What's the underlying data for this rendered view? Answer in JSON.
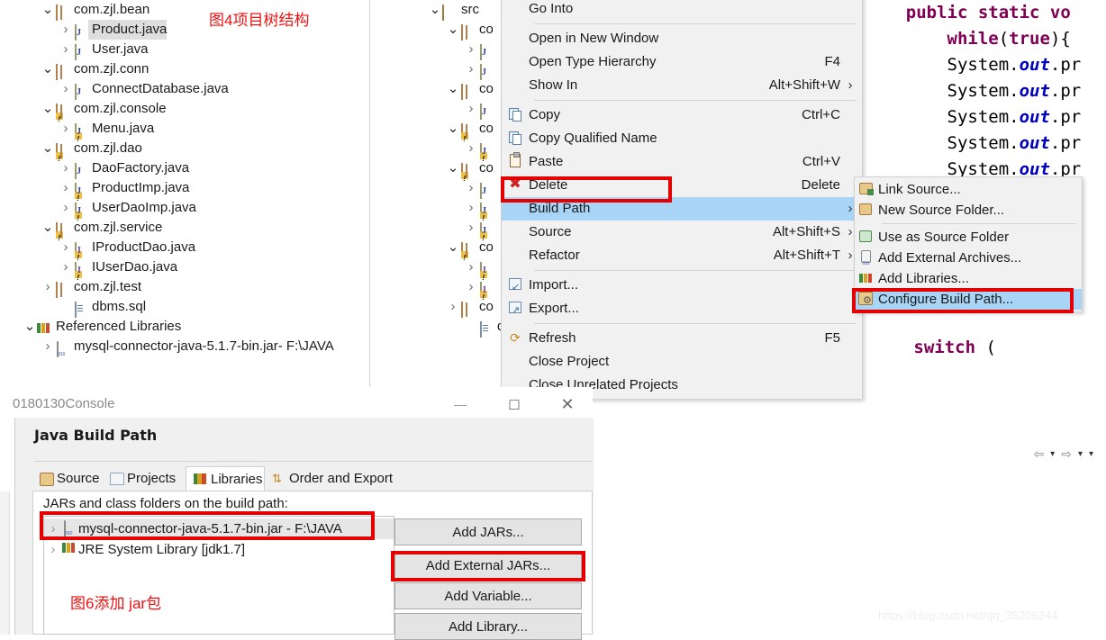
{
  "package_explorer": {
    "name": "Package Explorer Tree",
    "rows": [
      {
        "indent": 1,
        "twist": "open",
        "icon": "package-icon",
        "label": "com.zjl.bean",
        "selected": false
      },
      {
        "indent": 2,
        "twist": "closed",
        "icon": "java-file-icon",
        "label": "Product.java",
        "selected": true
      },
      {
        "indent": 2,
        "twist": "closed",
        "icon": "java-file-icon",
        "label": "User.java",
        "selected": false
      },
      {
        "indent": 1,
        "twist": "open",
        "icon": "package-icon",
        "label": "com.zjl.conn",
        "selected": false
      },
      {
        "indent": 2,
        "twist": "closed",
        "icon": "java-file-icon",
        "label": "ConnectDatabase.java",
        "selected": false
      },
      {
        "indent": 1,
        "twist": "open",
        "icon": "package-warning-icon",
        "label": "com.zjl.console",
        "selected": false
      },
      {
        "indent": 2,
        "twist": "closed",
        "icon": "java-file-warning-icon",
        "label": "Menu.java",
        "selected": false
      },
      {
        "indent": 1,
        "twist": "open",
        "icon": "package-warning-icon",
        "label": "com.zjl.dao",
        "selected": false
      },
      {
        "indent": 2,
        "twist": "closed",
        "icon": "java-file-icon",
        "label": "DaoFactory.java",
        "selected": false
      },
      {
        "indent": 2,
        "twist": "closed",
        "icon": "java-file-warning-icon",
        "label": "ProductImp.java",
        "selected": false
      },
      {
        "indent": 2,
        "twist": "closed",
        "icon": "java-file-warning-icon",
        "label": "UserDaoImp.java",
        "selected": false
      },
      {
        "indent": 1,
        "twist": "open",
        "icon": "package-warning-icon",
        "label": "com.zjl.service",
        "selected": false
      },
      {
        "indent": 2,
        "twist": "closed",
        "icon": "interface-file-warning-icon",
        "label": "IProductDao.java",
        "selected": false
      },
      {
        "indent": 2,
        "twist": "closed",
        "icon": "interface-file-warning-icon",
        "label": "IUserDao.java",
        "selected": false
      },
      {
        "indent": 1,
        "twist": "closed",
        "icon": "package-icon",
        "label": "com.zjl.test",
        "selected": false
      },
      {
        "indent": 2,
        "twist": "none",
        "icon": "sql-file-icon",
        "label": "dbms.sql",
        "selected": false
      },
      {
        "indent": 0,
        "twist": "open",
        "icon": "library-icon",
        "label": "Referenced Libraries",
        "selected": false
      },
      {
        "indent": 1,
        "twist": "closed",
        "icon": "jar-icon",
        "label": "mysql-connector-java-5.1.7-bin.jar",
        "dim": " - F:\\JAVA",
        "selected": false
      }
    ]
  },
  "second_tree": {
    "name": "Project Explorer (behind menu)",
    "rows": [
      {
        "indent": 0,
        "twist": "open",
        "icon": "source-folder-icon",
        "label": "src"
      },
      {
        "indent": 1,
        "twist": "open",
        "icon": "package-icon",
        "label": "co"
      },
      {
        "indent": 2,
        "twist": "closed",
        "icon": "java-file-icon",
        "label": ""
      },
      {
        "indent": 2,
        "twist": "closed",
        "icon": "java-file-icon",
        "label": ""
      },
      {
        "indent": 1,
        "twist": "open",
        "icon": "package-icon",
        "label": "co"
      },
      {
        "indent": 2,
        "twist": "closed",
        "icon": "java-file-icon",
        "label": ""
      },
      {
        "indent": 1,
        "twist": "open",
        "icon": "package-warning-icon",
        "label": "co"
      },
      {
        "indent": 2,
        "twist": "closed",
        "icon": "java-file-warning-icon",
        "label": ""
      },
      {
        "indent": 1,
        "twist": "open",
        "icon": "package-warning-icon",
        "label": "co"
      },
      {
        "indent": 2,
        "twist": "closed",
        "icon": "java-file-icon",
        "label": ""
      },
      {
        "indent": 2,
        "twist": "closed",
        "icon": "java-file-warning-icon",
        "label": ""
      },
      {
        "indent": 2,
        "twist": "closed",
        "icon": "java-file-warning-icon",
        "label": ""
      },
      {
        "indent": 1,
        "twist": "open",
        "icon": "package-warning-icon",
        "label": "co"
      },
      {
        "indent": 2,
        "twist": "closed",
        "icon": "interface-file-warning-icon",
        "label": ""
      },
      {
        "indent": 2,
        "twist": "closed",
        "icon": "interface-file-warning-icon",
        "label": ""
      },
      {
        "indent": 1,
        "twist": "closed",
        "icon": "package-icon",
        "label": "co"
      },
      {
        "indent": 2,
        "twist": "none",
        "icon": "sql-file-icon",
        "label": "db"
      }
    ]
  },
  "annotations": {
    "tree_structure": "图4项目树结构",
    "add_jar": "图6添加 jar包"
  },
  "code_editor": {
    "name": "Java source editor",
    "lines": [
      {
        "segments": [
          {
            "t": "    ",
            "c": "pln"
          },
          {
            "t": "public static vo",
            "c": "kw"
          }
        ]
      },
      {
        "segments": [
          {
            "t": "        ",
            "c": "pln"
          },
          {
            "t": "while",
            "c": "kw"
          },
          {
            "t": "(",
            "c": "pln"
          },
          {
            "t": "true",
            "c": "kw"
          },
          {
            "t": "){",
            "c": "pln"
          }
        ]
      },
      {
        "segments": [
          {
            "t": "        System.",
            "c": "pln"
          },
          {
            "t": "out",
            "c": "fld"
          },
          {
            "t": ".pr",
            "c": "pln"
          }
        ]
      },
      {
        "segments": [
          {
            "t": "        System.",
            "c": "pln"
          },
          {
            "t": "out",
            "c": "fld"
          },
          {
            "t": ".pr",
            "c": "pln"
          }
        ]
      },
      {
        "segments": [
          {
            "t": "        System.",
            "c": "pln"
          },
          {
            "t": "out",
            "c": "fld"
          },
          {
            "t": ".pr",
            "c": "pln"
          }
        ]
      },
      {
        "segments": [
          {
            "t": "        System.",
            "c": "pln"
          },
          {
            "t": "out",
            "c": "fld"
          },
          {
            "t": ".pr",
            "c": "pln"
          }
        ]
      },
      {
        "segments": [
          {
            "t": "        System.",
            "c": "pln"
          },
          {
            "t": "out",
            "c": "fld"
          },
          {
            "t": ".pr",
            "c": "pln"
          }
        ]
      },
      {
        "segments": [
          {
            "t": "        System.",
            "c": "pln"
          },
          {
            "t": "out",
            "c": "fld"
          },
          {
            "t": ".pr",
            "c": "pln"
          }
        ]
      }
    ],
    "lower_line": {
      "segments": [
        {
          "t": "          ",
          "c": "pln"
        },
        {
          "t": "switch",
          "c": "kw"
        },
        {
          "t": " (",
          "c": "pln"
        }
      ]
    }
  },
  "context_menu": {
    "name": "Eclipse project context menu",
    "items": [
      {
        "label": "Go Into",
        "accel": "",
        "icon": "",
        "arrow": false,
        "highlighted": false,
        "sep_after": true
      },
      {
        "label": "Open in New Window",
        "accel": "",
        "icon": "",
        "arrow": false,
        "highlighted": false
      },
      {
        "label": "Open Type Hierarchy",
        "accel": "F4",
        "icon": "",
        "arrow": false,
        "highlighted": false
      },
      {
        "label": "Show In",
        "accel": "Alt+Shift+W",
        "icon": "",
        "arrow": true,
        "highlighted": false,
        "sep_after": true
      },
      {
        "label": "Copy",
        "accel": "Ctrl+C",
        "icon": "copy-icon",
        "arrow": false,
        "highlighted": false
      },
      {
        "label": "Copy Qualified Name",
        "accel": "",
        "icon": "copy-qualified-icon",
        "arrow": false,
        "highlighted": false
      },
      {
        "label": "Paste",
        "accel": "Ctrl+V",
        "icon": "paste-icon",
        "arrow": false,
        "highlighted": false
      },
      {
        "label": "Delete",
        "accel": "Delete",
        "icon": "delete-icon",
        "arrow": false,
        "highlighted": false
      },
      {
        "label": "Build Path",
        "accel": "",
        "icon": "",
        "arrow": true,
        "highlighted": true
      },
      {
        "label": "Source",
        "accel": "Alt+Shift+S",
        "icon": "",
        "arrow": true,
        "highlighted": false
      },
      {
        "label": "Refactor",
        "accel": "Alt+Shift+T",
        "icon": "",
        "arrow": true,
        "highlighted": false,
        "sep_after": true
      },
      {
        "label": "Import...",
        "accel": "",
        "icon": "import-icon",
        "arrow": false,
        "highlighted": false
      },
      {
        "label": "Export...",
        "accel": "",
        "icon": "export-icon",
        "arrow": false,
        "highlighted": false,
        "sep_after": true
      },
      {
        "label": "Refresh",
        "accel": "F5",
        "icon": "refresh-icon",
        "arrow": false,
        "highlighted": false
      },
      {
        "label": "Close Project",
        "accel": "",
        "icon": "",
        "arrow": false,
        "highlighted": false
      },
      {
        "label": "Close Unrelated Projects",
        "accel": "",
        "icon": "",
        "arrow": false,
        "highlighted": false
      }
    ]
  },
  "submenu": {
    "name": "Build Path submenu",
    "items": [
      {
        "label": "Link Source...",
        "icon": "link-source-icon",
        "highlighted": false
      },
      {
        "label": "New Source Folder...",
        "icon": "new-source-folder-icon",
        "highlighted": false,
        "sep_after": true
      },
      {
        "label": "Use as Source Folder",
        "icon": "use-as-source-folder-icon",
        "highlighted": false
      },
      {
        "label": "Add External Archives...",
        "icon": "add-external-archives-icon",
        "highlighted": false
      },
      {
        "label": "Add Libraries...",
        "icon": "add-libraries-icon",
        "highlighted": false
      },
      {
        "label": "Configure Build Path...",
        "icon": "configure-build-path-icon",
        "highlighted": true
      }
    ]
  },
  "build_path_window": {
    "name": "Java Build Path properties window",
    "window_title": "0180130Console",
    "minimize_label": "—",
    "maximize_label": "□",
    "close_label": "✕",
    "dialog_title": "Java Build Path",
    "nav": {
      "back": "⇦",
      "back_menu": "▾",
      "forward": "⇨",
      "forward_menu": "▾",
      "view_menu": "▾"
    },
    "tabs": [
      {
        "label": "Source",
        "icon": "source-tab-icon",
        "active": false
      },
      {
        "label": "Projects",
        "icon": "projects-tab-icon",
        "active": false
      },
      {
        "label": "Libraries",
        "icon": "libraries-tab-icon",
        "active": true
      },
      {
        "label": "Order and Export",
        "icon": "order-export-tab-icon",
        "active": false
      }
    ],
    "list_caption": "JARs and class folders on the build path:",
    "entries": [
      {
        "label": "mysql-connector-java-5.1.7-bin.jar - F:\\JAVA",
        "icon": "jar-icon",
        "selected": true
      },
      {
        "label": "JRE System Library [jdk1.7]",
        "icon": "library-icon",
        "selected": false
      }
    ],
    "buttons": [
      {
        "label": "Add JARs...",
        "highlighted": false
      },
      {
        "label": "Add External JARs...",
        "highlighted": true
      },
      {
        "label": "Add Variable...",
        "highlighted": false
      },
      {
        "label": "Add Library...",
        "highlighted": false
      }
    ]
  },
  "watermark": "https://blog.csdn.net/qq_35206244",
  "colors": {
    "highlight_blue": "#a8d4f5",
    "annotation_red": "#ee1111",
    "redbox": "#e40000",
    "selection_gray": "#dedede"
  }
}
